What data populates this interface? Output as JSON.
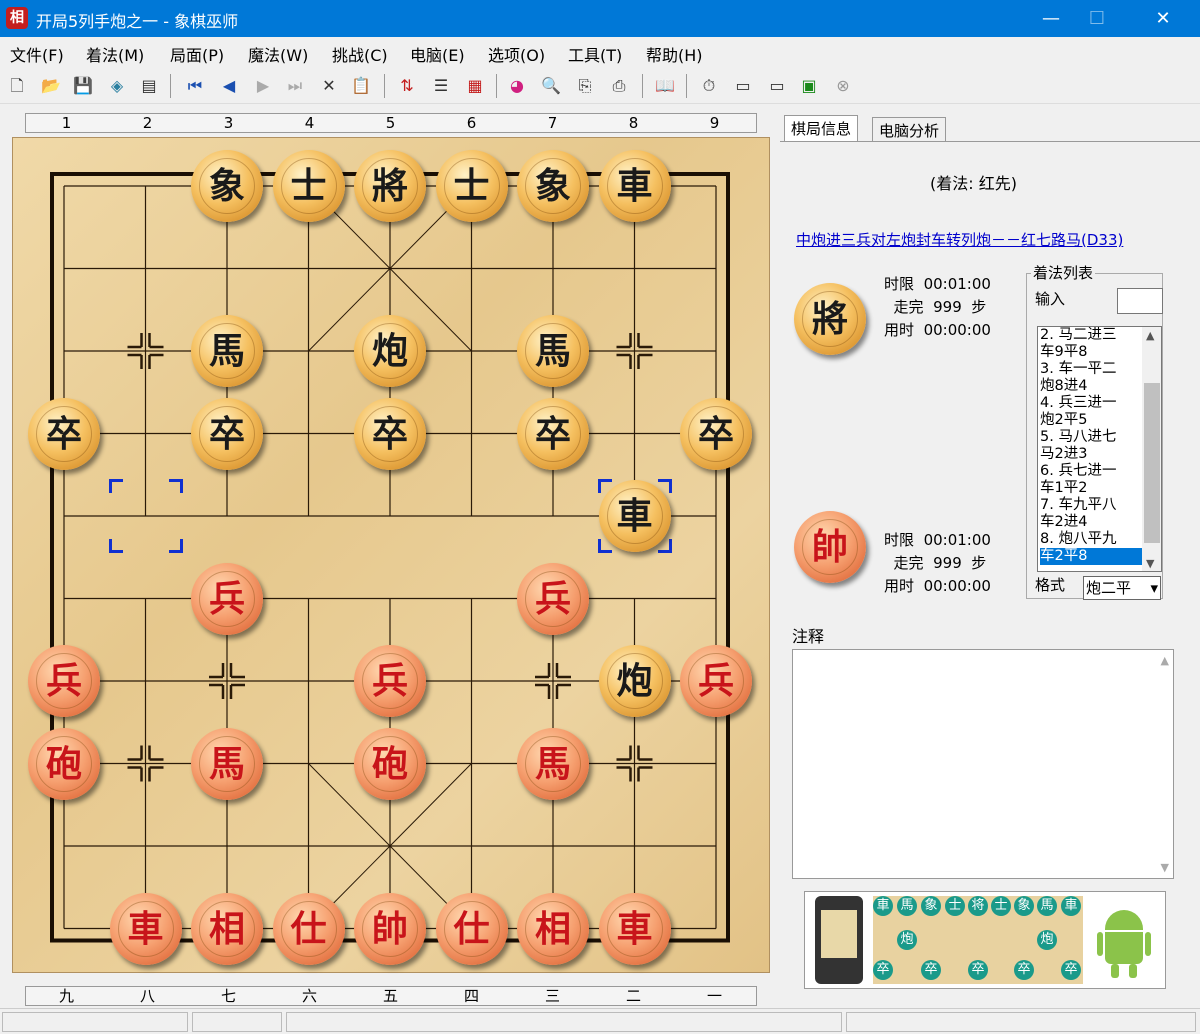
{
  "window": {
    "title": "开局5列手炮之一 - 象棋巫师",
    "app_icon_char": "相",
    "minimize": "—",
    "maximize": "☐",
    "close": "✕"
  },
  "menu": [
    "文件(F)",
    "着法(M)",
    "局面(P)",
    "魔法(W)",
    "挑战(C)",
    "电脑(E)",
    "选项(O)",
    "工具(T)",
    "帮助(H)"
  ],
  "toolbar": [
    "new-icon",
    "open-icon",
    "save-icon",
    "save-as-icon",
    "properties-icon",
    "first-move-icon",
    "prev-move-icon",
    "next-move-icon",
    "last-move-icon",
    "delete-icon",
    "paste-icon",
    "flip-icon",
    "tree-icon",
    "calculator-icon",
    "color-wheel-icon",
    "search-board-icon",
    "export-icon",
    "print-icon",
    "book-icon",
    "timer-icon",
    "engine1-icon",
    "engine2-icon",
    "chart-icon",
    "stop-icon"
  ],
  "board": {
    "top_numbers": [
      "1",
      "2",
      "3",
      "4",
      "5",
      "6",
      "7",
      "8",
      "9"
    ],
    "bottom_numbers": [
      "九",
      "八",
      "七",
      "六",
      "五",
      "四",
      "三",
      "二",
      "一"
    ],
    "pieces": [
      {
        "char": "象",
        "side": "black",
        "file": 3,
        "rank": 0
      },
      {
        "char": "士",
        "side": "black",
        "file": 4,
        "rank": 0
      },
      {
        "char": "將",
        "side": "black",
        "file": 5,
        "rank": 0
      },
      {
        "char": "士",
        "side": "black",
        "file": 6,
        "rank": 0
      },
      {
        "char": "象",
        "side": "black",
        "file": 7,
        "rank": 0
      },
      {
        "char": "車",
        "side": "black",
        "file": 8,
        "rank": 0
      },
      {
        "char": "馬",
        "side": "black",
        "file": 3,
        "rank": 2
      },
      {
        "char": "炮",
        "side": "black",
        "file": 5,
        "rank": 2
      },
      {
        "char": "馬",
        "side": "black",
        "file": 7,
        "rank": 2
      },
      {
        "char": "卒",
        "side": "black",
        "file": 1,
        "rank": 3
      },
      {
        "char": "卒",
        "side": "black",
        "file": 3,
        "rank": 3
      },
      {
        "char": "卒",
        "side": "black",
        "file": 5,
        "rank": 3
      },
      {
        "char": "卒",
        "side": "black",
        "file": 7,
        "rank": 3
      },
      {
        "char": "卒",
        "side": "black",
        "file": 9,
        "rank": 3
      },
      {
        "char": "車",
        "side": "black",
        "file": 8,
        "rank": 4
      },
      {
        "char": "炮",
        "side": "black",
        "file": 8,
        "rank": 6
      },
      {
        "char": "兵",
        "side": "red",
        "file": 3,
        "rank": 5
      },
      {
        "char": "兵",
        "side": "red",
        "file": 7,
        "rank": 5
      },
      {
        "char": "兵",
        "side": "red",
        "file": 1,
        "rank": 6
      },
      {
        "char": "兵",
        "side": "red",
        "file": 5,
        "rank": 6
      },
      {
        "char": "兵",
        "side": "red",
        "file": 9,
        "rank": 6
      },
      {
        "char": "砲",
        "side": "red",
        "file": 1,
        "rank": 7
      },
      {
        "char": "馬",
        "side": "red",
        "file": 3,
        "rank": 7
      },
      {
        "char": "砲",
        "side": "red",
        "file": 5,
        "rank": 7
      },
      {
        "char": "馬",
        "side": "red",
        "file": 7,
        "rank": 7
      },
      {
        "char": "車",
        "side": "red",
        "file": 2,
        "rank": 9
      },
      {
        "char": "相",
        "side": "red",
        "file": 3,
        "rank": 9
      },
      {
        "char": "仕",
        "side": "red",
        "file": 4,
        "rank": 9
      },
      {
        "char": "帥",
        "side": "red",
        "file": 5,
        "rank": 9
      },
      {
        "char": "仕",
        "side": "red",
        "file": 6,
        "rank": 9
      },
      {
        "char": "相",
        "side": "red",
        "file": 7,
        "rank": 9
      },
      {
        "char": "車",
        "side": "red",
        "file": 8,
        "rank": 9
      }
    ],
    "selection_from": {
      "file": 2,
      "rank": 4
    },
    "selection_to": {
      "file": 8,
      "rank": 4
    }
  },
  "panel": {
    "tabs": [
      "棋局信息",
      "电脑分析"
    ],
    "move_type": "(着法: 红先)",
    "opening_link": "中炮进三兵对左炮封车转列炮－－红七路马(D33)",
    "black_player": {
      "piece": "將",
      "time_limit_label": "时限",
      "time_limit": "00:01:00",
      "moves_label": "走完",
      "moves": "999",
      "moves_unit": "步",
      "time_used_label": "用时",
      "time_used": "00:00:00"
    },
    "red_player": {
      "piece": "帥",
      "time_limit_label": "时限",
      "time_limit": "00:01:00",
      "moves_label": "走完",
      "moves": "999",
      "moves_unit": "步",
      "time_used_label": "用时",
      "time_used": "00:00:00"
    },
    "movelist_title": "着法列表",
    "input_label": "输入",
    "moves": [
      "2. 马二进三",
      "车9平8",
      "3. 车一平二",
      "炮8进4",
      "4. 兵三进一",
      "炮2平5",
      "5. 马八进七",
      "马2进3",
      "6. 兵七进一",
      "车1平2",
      "7. 车九平八",
      "车2进4",
      "8. 炮八平九",
      "车2平8"
    ],
    "selected_move": 13,
    "format_label": "格式",
    "format_value": "炮二平",
    "notes_label": "注释",
    "banner_pieces_top": [
      "車",
      "馬",
      "象",
      "士",
      "将",
      "士",
      "象",
      "馬",
      "車"
    ],
    "banner_pieces_mid": [
      "炮",
      "炮"
    ],
    "banner_pieces_bottom": [
      "卒",
      "卒",
      "卒",
      "卒",
      "卒"
    ]
  }
}
